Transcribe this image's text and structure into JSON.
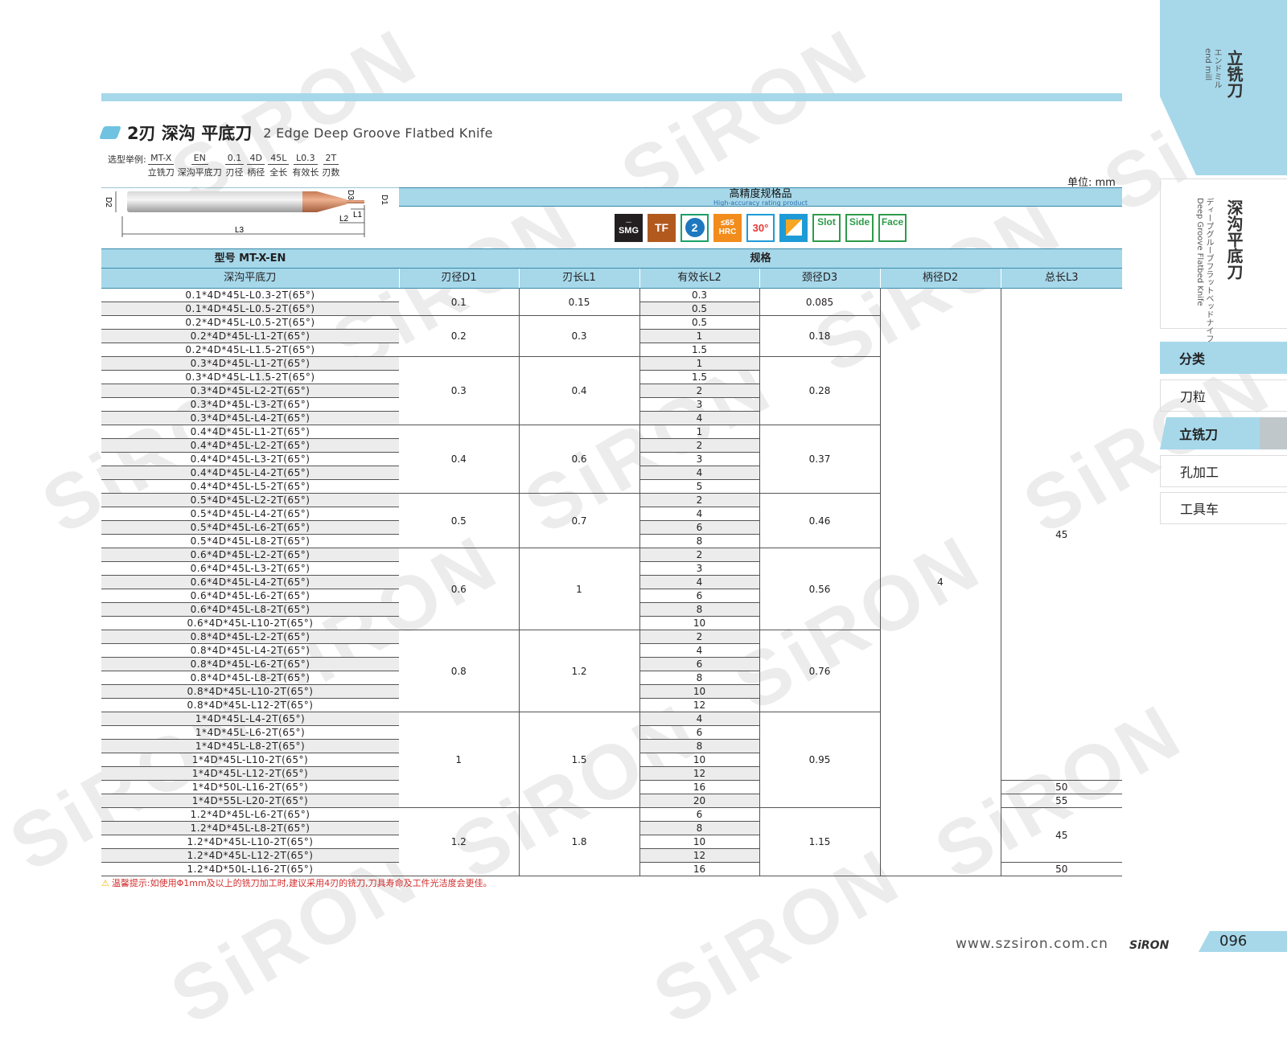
{
  "watermark": "SiRON",
  "title": {
    "cn": "2刃 深沟 平底刀",
    "en": "2 Edge Deep Groove Flatbed Knife"
  },
  "selection": {
    "label": "选型举例:",
    "items": [
      {
        "code": "MT-X",
        "desc": "立铣刀"
      },
      {
        "code": "EN",
        "desc": "深沟平底刀"
      },
      {
        "code": "0.1",
        "desc": "刃径"
      },
      {
        "code": "4D",
        "desc": "柄径"
      },
      {
        "code": "45L",
        "desc": "全长"
      },
      {
        "code": "L0.3",
        "desc": "有效长"
      },
      {
        "code": "2T",
        "desc": "刃数"
      }
    ]
  },
  "unit": "单位: mm",
  "diagram": {
    "d2": "D2",
    "d3": "D3",
    "d1": "D1",
    "l1": "L1",
    "l2": "L2",
    "l3": "L3"
  },
  "high_precision": {
    "cn": "高精度规格品",
    "en": "High-accuracy rating product"
  },
  "icons": [
    {
      "name": "smg-icon",
      "text": "SMG"
    },
    {
      "name": "tf-icon",
      "text": "TF"
    },
    {
      "name": "two-flute-icon",
      "text": "2"
    },
    {
      "name": "hrc65-icon",
      "text": "≤65 HRC"
    },
    {
      "name": "helix-30-icon",
      "text": "30°"
    },
    {
      "name": "shoulder-icon",
      "text": ""
    },
    {
      "name": "slot-icon",
      "text": "Slot"
    },
    {
      "name": "side-icon",
      "text": "Side"
    },
    {
      "name": "face-icon",
      "text": "Face"
    }
  ],
  "table": {
    "model_header": "型号 MT-X-EN",
    "spec_header": "规格",
    "col0": "深沟平底刀",
    "cols": [
      "刃径D1",
      "刃长L1",
      "有效长L2",
      "颈径D3",
      "柄径D2",
      "总长L3"
    ],
    "models": [
      "0.1*4D*45L-L0.3-2T(65°)",
      "0.1*4D*45L-L0.5-2T(65°)",
      "0.2*4D*45L-L0.5-2T(65°)",
      "0.2*4D*45L-L1-2T(65°)",
      "0.2*4D*45L-L1.5-2T(65°)",
      "0.3*4D*45L-L1-2T(65°)",
      "0.3*4D*45L-L1.5-2T(65°)",
      "0.3*4D*45L-L2-2T(65°)",
      "0.3*4D*45L-L3-2T(65°)",
      "0.3*4D*45L-L4-2T(65°)",
      "0.4*4D*45L-L1-2T(65°)",
      "0.4*4D*45L-L2-2T(65°)",
      "0.4*4D*45L-L3-2T(65°)",
      "0.4*4D*45L-L4-2T(65°)",
      "0.4*4D*45L-L5-2T(65°)",
      "0.5*4D*45L-L2-2T(65°)",
      "0.5*4D*45L-L4-2T(65°)",
      "0.5*4D*45L-L6-2T(65°)",
      "0.5*4D*45L-L8-2T(65°)",
      "0.6*4D*45L-L2-2T(65°)",
      "0.6*4D*45L-L3-2T(65°)",
      "0.6*4D*45L-L4-2T(65°)",
      "0.6*4D*45L-L6-2T(65°)",
      "0.6*4D*45L-L8-2T(65°)",
      "0.6*4D*45L-L10-2T(65°)",
      "0.8*4D*45L-L2-2T(65°)",
      "0.8*4D*45L-L4-2T(65°)",
      "0.8*4D*45L-L6-2T(65°)",
      "0.8*4D*45L-L8-2T(65°)",
      "0.8*4D*45L-L10-2T(65°)",
      "0.8*4D*45L-L12-2T(65°)",
      "1*4D*45L-L4-2T(65°)",
      "1*4D*45L-L6-2T(65°)",
      "1*4D*45L-L8-2T(65°)",
      "1*4D*45L-L10-2T(65°)",
      "1*4D*45L-L12-2T(65°)",
      "1*4D*50L-L16-2T(65°)",
      "1*4D*55L-L20-2T(65°)",
      "1.2*4D*45L-L6-2T(65°)",
      "1.2*4D*45L-L8-2T(65°)",
      "1.2*4D*45L-L10-2T(65°)",
      "1.2*4D*45L-L12-2T(65°)",
      "1.2*4D*50L-L16-2T(65°)"
    ],
    "l2": [
      "0.3",
      "0.5",
      "0.5",
      "1",
      "1.5",
      "1",
      "1.5",
      "2",
      "3",
      "4",
      "1",
      "2",
      "3",
      "4",
      "5",
      "2",
      "4",
      "6",
      "8",
      "2",
      "3",
      "4",
      "6",
      "8",
      "10",
      "2",
      "4",
      "6",
      "8",
      "10",
      "12",
      "4",
      "6",
      "8",
      "10",
      "12",
      "16",
      "20",
      "6",
      "8",
      "10",
      "12",
      "16"
    ],
    "groups": [
      {
        "span": 2,
        "d1": "0.1",
        "l1": "0.15",
        "d3": "0.085"
      },
      {
        "span": 3,
        "d1": "0.2",
        "l1": "0.3",
        "d3": "0.18"
      },
      {
        "span": 5,
        "d1": "0.3",
        "l1": "0.4",
        "d3": "0.28"
      },
      {
        "span": 5,
        "d1": "0.4",
        "l1": "0.6",
        "d3": "0.37"
      },
      {
        "span": 4,
        "d1": "0.5",
        "l1": "0.7",
        "d3": "0.46"
      },
      {
        "span": 6,
        "d1": "0.6",
        "l1": "1",
        "d3": "0.56"
      },
      {
        "span": 6,
        "d1": "0.8",
        "l1": "1.2",
        "d3": "0.76"
      },
      {
        "span": 7,
        "d1": "1",
        "l1": "1.5",
        "d3": "0.95"
      },
      {
        "span": 5,
        "d1": "1.2",
        "l1": "1.8",
        "d3": "1.15"
      }
    ],
    "d2": "4",
    "l3_groups": [
      {
        "span": 36,
        "v": "45"
      },
      {
        "span": 1,
        "v": "50"
      },
      {
        "span": 1,
        "v": "55"
      },
      {
        "span": 4,
        "v": "45"
      },
      {
        "span": 1,
        "v": "50"
      }
    ]
  },
  "warning": "温馨提示:如使用Φ1mm及以上的铣刀加工时,建议采用4刃的铣刀,刀具寿命及工件光洁度会更佳。",
  "footer": {
    "url": "www.szsiron.com.cn",
    "logo": "SiRON",
    "page": "096"
  },
  "sidebar": {
    "top_cn": "立铣刀",
    "top_en1": "end mill",
    "top_en2": "エンドミル",
    "sub_cn": "深沟平底刀",
    "sub_en1": "Deep Groove Flatbed Knife",
    "sub_en2": "ディープグルーブフラットベッドナイフ",
    "nav": [
      "分类",
      "刀粒",
      "立铣刀",
      "孔加工",
      "工具车"
    ]
  }
}
